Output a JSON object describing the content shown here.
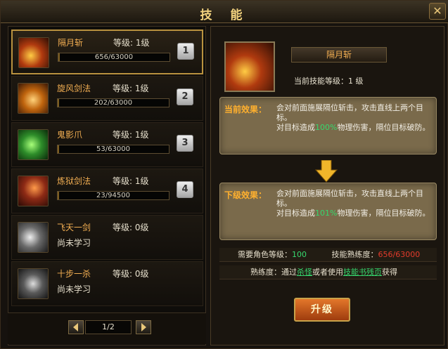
{
  "window": {
    "title": "技 能",
    "close_icon": "close-x"
  },
  "skills": [
    {
      "name": "隔月斩",
      "level_label": "等级:",
      "level": "1级",
      "progress": "656/63000",
      "progress_value": 656,
      "progress_max": 63000,
      "key": "1",
      "icon": "sword-slash-icon",
      "color": "#b03a0f",
      "learned": true
    },
    {
      "name": "旋风剑法",
      "level_label": "等级:",
      "level": "1级",
      "progress": "202/63000",
      "progress_value": 202,
      "progress_max": 63000,
      "key": "2",
      "icon": "whirlwind-icon",
      "color": "#c0650e",
      "learned": true
    },
    {
      "name": "鬼影爪",
      "level_label": "等级:",
      "level": "1级",
      "progress": "53/63000",
      "progress_value": 53,
      "progress_max": 63000,
      "key": "3",
      "icon": "ghost-claw-icon",
      "color": "#2e8d2a",
      "learned": true
    },
    {
      "name": "炼狱剑法",
      "level_label": "等级:",
      "level": "1级",
      "progress": "23/94500",
      "progress_value": 23,
      "progress_max": 94500,
      "key": "4",
      "icon": "inferno-sword-icon",
      "color": "#8d2a15",
      "learned": true
    },
    {
      "name": "飞天一剑",
      "level_label": "等级:",
      "level": "0级",
      "status": "尚未学习",
      "icon": "flying-sword-icon",
      "color": "#6a6a6a",
      "learned": false
    },
    {
      "name": "十步一杀",
      "level_label": "等级:",
      "level": "0级",
      "status": "尚未学习",
      "icon": "ten-step-kill-icon",
      "color": "#5a5a5a",
      "learned": false
    }
  ],
  "pager": {
    "text": "1/2"
  },
  "detail": {
    "name": "隔月斩",
    "current_level_label": "当前技能等级：",
    "current_level": "1 级",
    "current_effect_label": "当前效果：",
    "current_effect_line1": "会对前面施展隔位斩击，攻击直线上两个目标。",
    "current_effect_pre": "对目标造成",
    "current_effect_value": "100%",
    "current_effect_post": "物理伤害，隔位目标破防。",
    "next_effect_label": "下级效果：",
    "next_effect_line1": "会对前面施展隔位斩击，攻击直线上两个目标。",
    "next_effect_pre": "对目标造成",
    "next_effect_value": "101%",
    "next_effect_post": "物理伤害，隔位目标破防。",
    "req_level_label": "需要角色等级：",
    "req_level_value": "100",
    "req_skill_label": "技能熟练度：",
    "req_skill_value": "656/63000",
    "prof_label": "熟练度：",
    "prof_text_pre": "通过",
    "prof_link1": "杀怪",
    "prof_text_mid": "或者使用",
    "prof_link2": "技能书残页",
    "prof_text_post": "获得",
    "upgrade_button": "升级"
  },
  "colors": {
    "accent": "#f2ae52",
    "green": "#36d86e",
    "red": "#e43b2b",
    "gold": "#f3d37e"
  }
}
